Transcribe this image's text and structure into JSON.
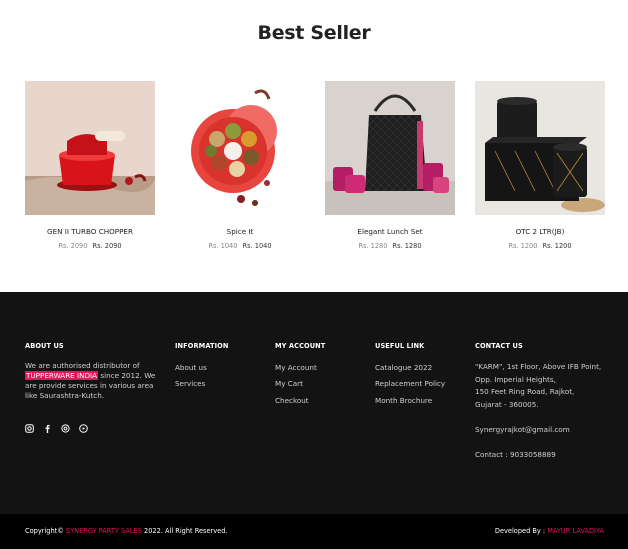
{
  "best_seller": {
    "title": "Best Seller",
    "products": [
      {
        "name": "GEN II TURBO CHOPPER",
        "old_price": "Rs. 2090",
        "price": "Rs. 2090"
      },
      {
        "name": "Spice It",
        "old_price": "Rs. 1040",
        "price": "Rs. 1040"
      },
      {
        "name": "Elegant Lunch Set",
        "old_price": "Rs. 1280",
        "price": "Rs. 1280"
      },
      {
        "name": "OTC 2 LTR(JB)",
        "old_price": "Rs. 1200",
        "price": "Rs. 1200"
      }
    ]
  },
  "footer": {
    "about": {
      "heading": "ABOUT US",
      "text_before": "We are authorised distributor of",
      "highlight": "TUPPERWARE INDIA",
      "text_after": "since 2012. We are provide services in various area like Saurashtra-Kutch.",
      "social_icons": [
        "instagram-icon",
        "facebook-icon",
        "threads-icon",
        "youtube-icon"
      ]
    },
    "information": {
      "heading": "INFORMATION",
      "links": [
        "About us",
        "Services"
      ]
    },
    "account": {
      "heading": "MY ACCOUNT",
      "links": [
        "My Account",
        "My Cart",
        "Checkout"
      ]
    },
    "useful": {
      "heading": "USEFUL LINK",
      "links": [
        "Catalogue 2022",
        "Replacement Policy",
        "Month Brochure"
      ]
    },
    "contact": {
      "heading": "CONTACT US",
      "address_lines": [
        "\"KARM\", 1st Floor, Above IFB Point,",
        "Opp. Imperial Heights,",
        "150 Feet Ring Road, Rajkot,",
        "Gujarat - 360005."
      ],
      "email": "Synergyrajkot@gmail.com",
      "phone": "Contact : 9033058889"
    }
  },
  "copyright": {
    "prefix": "Copyright©",
    "brand": "SYNERGY PARTY SALES",
    "suffix": "2022. All Right Reserved.",
    "dev_label": "Developed By :",
    "dev_name": "MAYUR LAVADIYA"
  },
  "colors": {
    "accent": "#e1175a",
    "footer_bg": "#131313",
    "bottom_bar_bg": "#000000"
  }
}
